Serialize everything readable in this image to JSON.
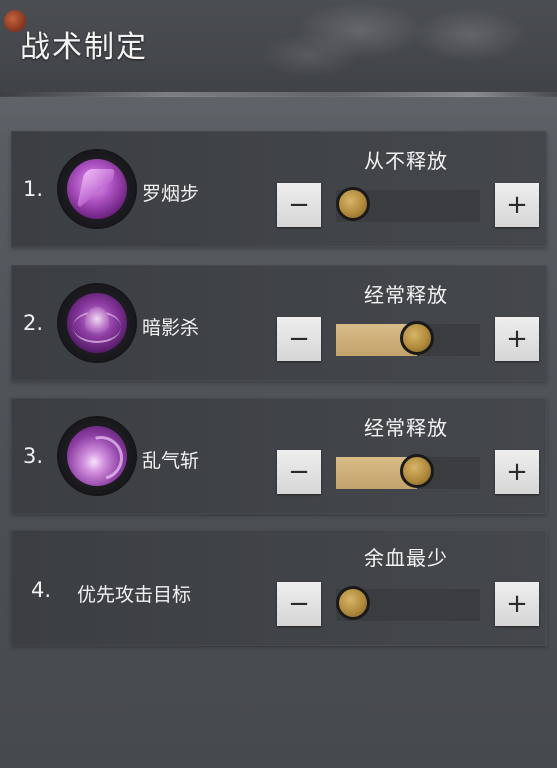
{
  "header": {
    "title": "战术制定"
  },
  "rows": [
    {
      "number": "1.",
      "skill_name": "罗烟步",
      "icon": "shadow-step-skill-icon",
      "mode_label": "从不释放",
      "slider_level": 0.0
    },
    {
      "number": "2.",
      "skill_name": "暗影杀",
      "icon": "spider-shadow-kill-skill-icon",
      "mode_label": "经常释放",
      "slider_level": 0.5
    },
    {
      "number": "3.",
      "skill_name": "乱气斩",
      "icon": "chaos-qi-slash-skill-icon",
      "mode_label": "经常释放",
      "slider_level": 0.5
    },
    {
      "number": "4.",
      "target_label": "优先攻击目标",
      "mode_label": "余血最少",
      "slider_level": 0.0
    }
  ],
  "controls": {
    "minus_label": "−",
    "plus_label": "+"
  },
  "colors": {
    "slider_fill": "#c9a86f",
    "knob": "#b18a3c",
    "header_accent": "#c0562e"
  }
}
